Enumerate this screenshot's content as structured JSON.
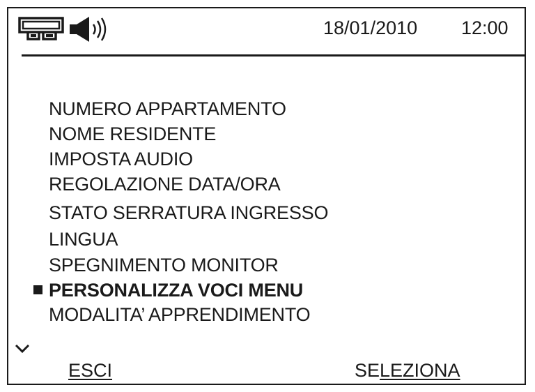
{
  "status_bar": {
    "icons": [
      "intercom-icon",
      "speaker-volume-icon"
    ],
    "date": "18/01/2010",
    "time": "12:00"
  },
  "menu": {
    "items": [
      {
        "label": "NUMERO APPARTAMENTO"
      },
      {
        "label": "NOME RESIDENTE"
      },
      {
        "label": "IMPOSTA AUDIO"
      },
      {
        "label": "REGOLAZIONE DATA/ORA"
      },
      {
        "label": "STATO SERRATURA INGRESSO"
      },
      {
        "label": "LINGUA"
      },
      {
        "label": "SPEGNIMENTO MONITOR"
      },
      {
        "label": "PERSONALIZZA VOCI MENU",
        "selected": true
      },
      {
        "label": "MODALITA’ APPRENDIMENTO"
      }
    ],
    "scroll_icon": "chevron-down-icon"
  },
  "softkeys": {
    "left_label": "ESCI",
    "right_label_start": "SE",
    "right_label_underlined": "LEZIONA"
  },
  "colors": {
    "ink": "#1a1a1a",
    "background": "#ffffff"
  }
}
